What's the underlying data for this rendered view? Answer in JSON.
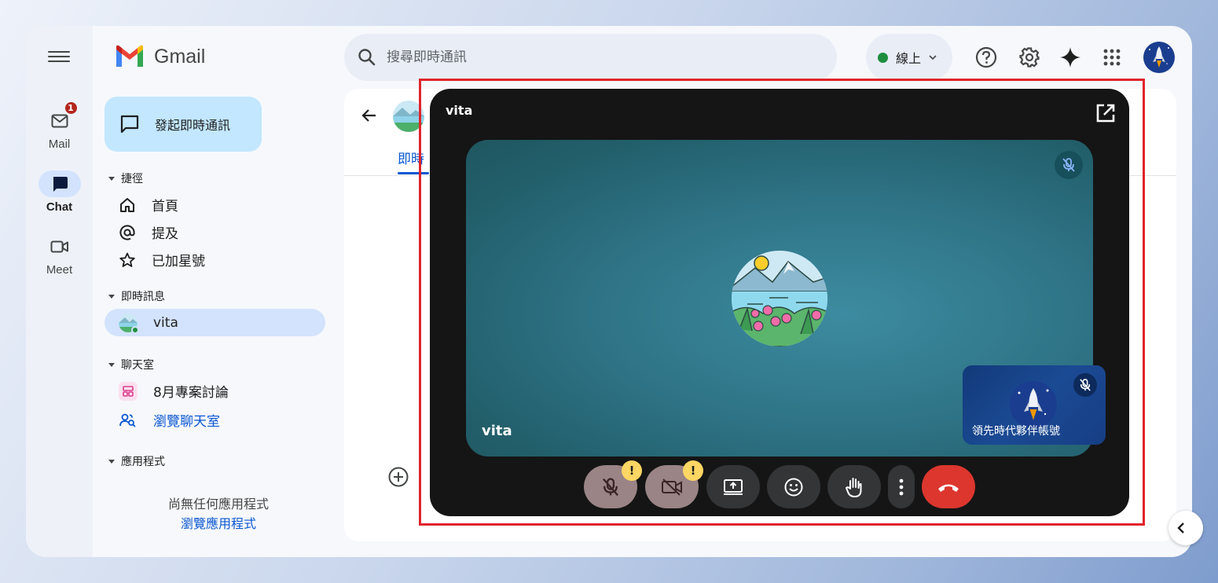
{
  "app": {
    "name": "Gmail"
  },
  "rail": {
    "items": [
      {
        "label": "Mail",
        "badge": "1"
      },
      {
        "label": "Chat"
      },
      {
        "label": "Meet"
      }
    ]
  },
  "sidebar": {
    "compose_label": "發起即時通訊",
    "shortcuts": {
      "heading": "捷徑",
      "items": [
        {
          "label": "首頁"
        },
        {
          "label": "提及"
        },
        {
          "label": "已加星號"
        }
      ]
    },
    "direct_messages": {
      "heading": "即時訊息",
      "items": [
        {
          "label": "vita"
        }
      ]
    },
    "spaces": {
      "heading": "聊天室",
      "items": [
        {
          "label": "8月專案討論"
        }
      ],
      "browse_label": "瀏覽聊天室"
    },
    "apps": {
      "heading": "應用程式",
      "empty_text": "尚無任何應用程式",
      "browse_label": "瀏覽應用程式"
    }
  },
  "search": {
    "placeholder": "搜尋即時通訊"
  },
  "status": {
    "label": "線上"
  },
  "main": {
    "tab_label": "即時"
  },
  "call": {
    "title": "vita",
    "stage_name": "vita",
    "self_name": "領先時代夥伴帳號",
    "warning_mark": "!"
  },
  "colors": {
    "accent": "#0b57d0",
    "compose": "#c2e7ff",
    "active_nav": "#d3e3fd",
    "highlight_border": "#e0242c",
    "end_call": "#dc362e",
    "online": "#1e8e3e"
  }
}
